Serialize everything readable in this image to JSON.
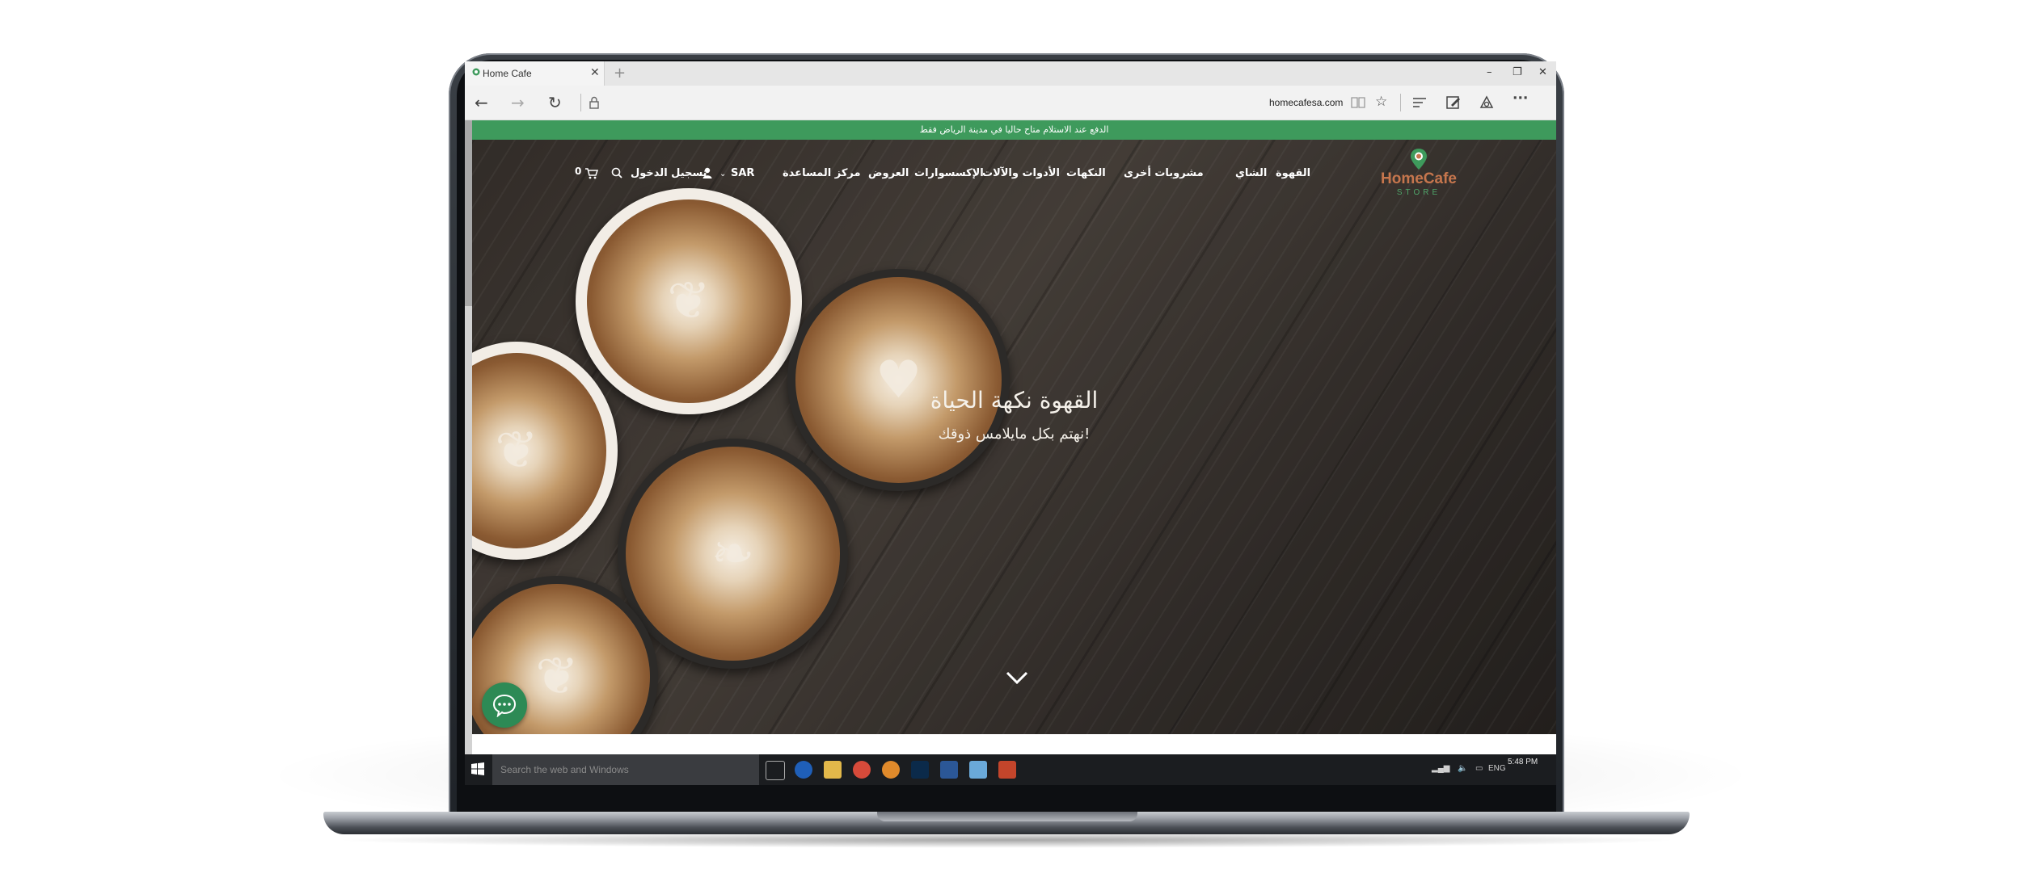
{
  "browser": {
    "tab_title": "Home Cafe",
    "new_tab": "+",
    "url": "homecafesa.com",
    "window_controls": [
      "–",
      "❐",
      "✕"
    ],
    "nav": {
      "back": "←",
      "forward": "→",
      "refresh": "↻",
      "lock_icon": "lock-icon"
    },
    "toolbar_icons": [
      "reading-view-icon",
      "favorite-star-icon",
      "hub-icon",
      "web-note-icon",
      "share-icon",
      "more-icon"
    ]
  },
  "site": {
    "promo_banner": "الدفع عند الاستلام متاح حاليا في مدينة الرياض فقط",
    "logo": {
      "name": "HomeCafe",
      "tagline": "STORE"
    },
    "menu": [
      {
        "label": "القهوة"
      },
      {
        "label": "الشاي"
      },
      {
        "label": "مشروبات أخرى"
      },
      {
        "label": "النكهات"
      },
      {
        "label": "الأدوات والآلات"
      },
      {
        "label": "الإكسسوارات"
      },
      {
        "label": "العروض"
      },
      {
        "label": "مركز المساعدة"
      }
    ],
    "currency": "SAR",
    "login": "تسجيل الدخول",
    "cart_count": "0",
    "hero": {
      "title": "القهوة نكهة الحياة",
      "subtitle": "نهتم بكل مايلامس ذوقك!"
    },
    "colors": {
      "brand_green": "#3e9a5c",
      "brand_orange": "#c6764d",
      "chat_green": "#2d8a55"
    }
  },
  "taskbar": {
    "search_placeholder": "Search the web and Windows",
    "language": "ENG",
    "time": "5:48 PM"
  }
}
